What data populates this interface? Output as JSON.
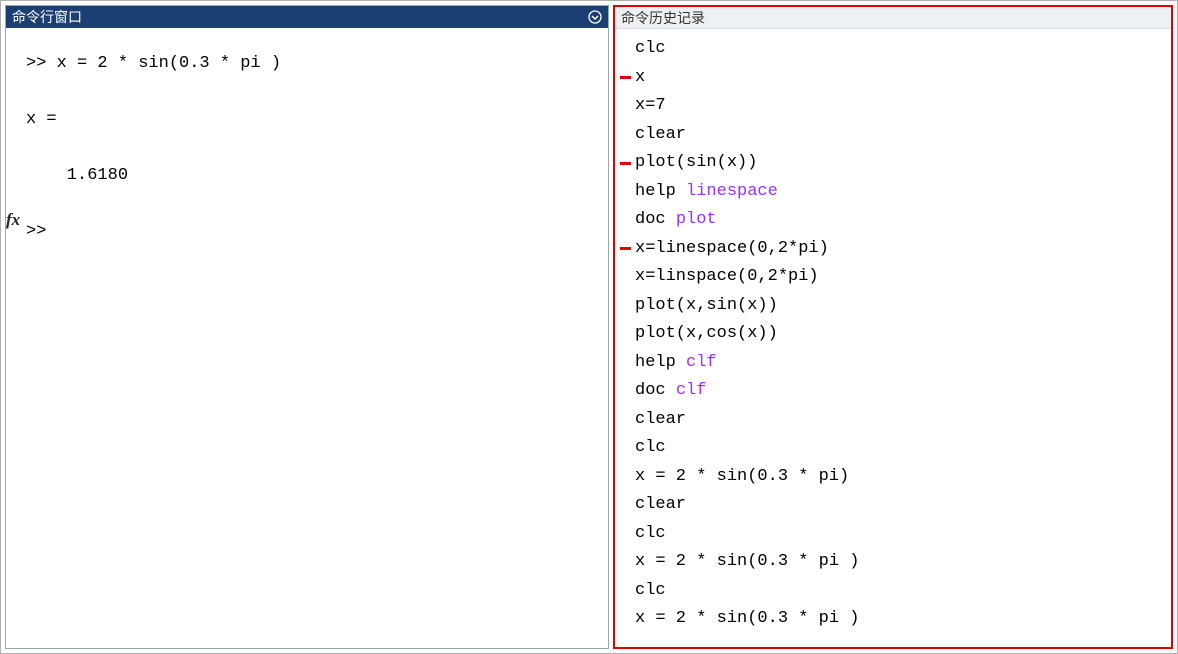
{
  "command_window": {
    "title": "命令行窗口",
    "fx_label": "fx",
    "lines": [
      ">> x = 2 * sin(0.3 * pi )",
      "",
      "x =",
      "",
      "    1.6180",
      "",
      ">> "
    ]
  },
  "history": {
    "title": "命令历史记录",
    "items": [
      {
        "mark": false,
        "segments": [
          {
            "t": "clc"
          }
        ]
      },
      {
        "mark": true,
        "segments": [
          {
            "t": "x"
          }
        ]
      },
      {
        "mark": false,
        "segments": [
          {
            "t": "x=7"
          }
        ]
      },
      {
        "mark": false,
        "segments": [
          {
            "t": "clear"
          }
        ]
      },
      {
        "mark": true,
        "segments": [
          {
            "t": "plot(sin(x))"
          }
        ]
      },
      {
        "mark": false,
        "segments": [
          {
            "t": "help "
          },
          {
            "t": "linespace",
            "c": "kw-purple"
          }
        ]
      },
      {
        "mark": false,
        "segments": [
          {
            "t": "doc "
          },
          {
            "t": "plot",
            "c": "kw-purple"
          }
        ]
      },
      {
        "mark": true,
        "segments": [
          {
            "t": "x=linespace(0,2*pi)"
          }
        ]
      },
      {
        "mark": false,
        "segments": [
          {
            "t": "x=linspace(0,2*pi)"
          }
        ]
      },
      {
        "mark": false,
        "segments": [
          {
            "t": "plot(x,sin(x))"
          }
        ]
      },
      {
        "mark": false,
        "segments": [
          {
            "t": "plot(x,cos(x))"
          }
        ]
      },
      {
        "mark": false,
        "segments": [
          {
            "t": "help "
          },
          {
            "t": "clf",
            "c": "kw-purple"
          }
        ]
      },
      {
        "mark": false,
        "segments": [
          {
            "t": "doc "
          },
          {
            "t": "clf",
            "c": "kw-purple"
          }
        ]
      },
      {
        "mark": false,
        "segments": [
          {
            "t": "clear"
          }
        ]
      },
      {
        "mark": false,
        "segments": [
          {
            "t": "clc"
          }
        ]
      },
      {
        "mark": false,
        "segments": [
          {
            "t": "x = 2 * sin(0.3 * pi)"
          }
        ]
      },
      {
        "mark": false,
        "segments": [
          {
            "t": "clear"
          }
        ]
      },
      {
        "mark": false,
        "segments": [
          {
            "t": "clc"
          }
        ]
      },
      {
        "mark": false,
        "segments": [
          {
            "t": "x = 2 * sin(0.3 * pi )"
          }
        ]
      },
      {
        "mark": false,
        "segments": [
          {
            "t": "clc"
          }
        ]
      },
      {
        "mark": false,
        "segments": [
          {
            "t": "x = 2 * sin(0.3 * pi )"
          }
        ]
      }
    ]
  }
}
